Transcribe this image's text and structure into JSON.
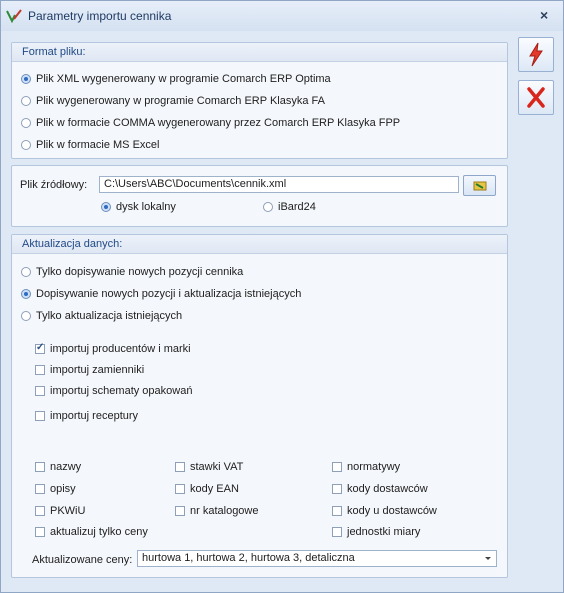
{
  "window": {
    "title": "Parametry importu cennika"
  },
  "toolbar": {
    "confirm_icon": "lightning-bolt-icon",
    "cancel_icon": "red-x-icon"
  },
  "format_group": {
    "title": "Format pliku:",
    "options": [
      {
        "label": "Plik XML wygenerowany w programie Comarch ERP Optima",
        "selected": true
      },
      {
        "label": "Plik wygenerowany w programie Comarch ERP Klasyka FA",
        "selected": false
      },
      {
        "label": "Plik w formacie COMMA wygenerowany przez Comarch ERP Klasyka FPP",
        "selected": false
      },
      {
        "label": "Plik w formacie MS Excel",
        "selected": false
      }
    ]
  },
  "source": {
    "label": "Plik źródłowy:",
    "path": "C:\\Users\\ABC\\Documents\\cennik.xml",
    "locations": [
      {
        "label": "dysk lokalny",
        "selected": true
      },
      {
        "label": "iBard24",
        "selected": false
      }
    ]
  },
  "update_group": {
    "title": "Aktualizacja danych:",
    "modes": [
      {
        "label": "Tylko dopisywanie nowych pozycji cennika",
        "selected": false
      },
      {
        "label": "Dopisywanie nowych pozycji i aktualizacja istniejących",
        "selected": true
      },
      {
        "label": "Tylko aktualizacja istniejących",
        "selected": false
      }
    ],
    "imports": [
      {
        "label": "importuj producentów i marki",
        "checked": true
      },
      {
        "label": "importuj zamienniki",
        "checked": false
      },
      {
        "label": "importuj schematy opakowań",
        "checked": false
      },
      {
        "label": "importuj receptury",
        "checked": false
      }
    ],
    "fields_col1": [
      {
        "label": "nazwy",
        "checked": false
      },
      {
        "label": "opisy",
        "checked": false
      },
      {
        "label": "PKWiU",
        "checked": false
      },
      {
        "label": "aktualizuj tylko ceny",
        "checked": false
      }
    ],
    "fields_col2": [
      {
        "label": "stawki VAT",
        "checked": false
      },
      {
        "label": "kody EAN",
        "checked": false
      },
      {
        "label": "nr katalogowe",
        "checked": false
      }
    ],
    "fields_col3": [
      {
        "label": "normatywy",
        "checked": false
      },
      {
        "label": "kody dostawców",
        "checked": false
      },
      {
        "label": "kody u dostawców",
        "checked": false
      },
      {
        "label": "jednostki miary",
        "checked": false
      }
    ],
    "prices_label": "Aktualizowane ceny:",
    "prices_value": "hurtowa 1, hurtowa 2, hurtowa 3, detaliczna"
  }
}
